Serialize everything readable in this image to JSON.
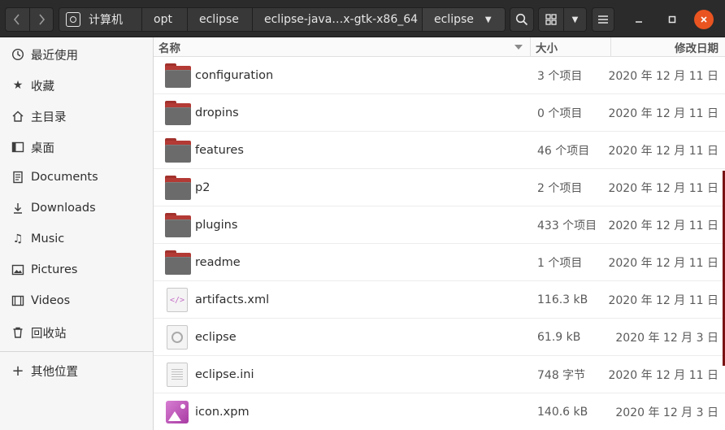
{
  "header": {
    "back_icon": "chevron-left-icon",
    "forward_icon": "chevron-right-icon",
    "breadcrumbs": [
      "计算机",
      "opt",
      "eclipse",
      "eclipse-java…x-gtk-x86_64",
      "eclipse"
    ],
    "search_icon": "search-icon",
    "view_icon": "grid-view-icon",
    "menu_icon": "hamburger-menu-icon",
    "window_controls": [
      "minimize",
      "maximize",
      "close"
    ],
    "close_color": "#e95420"
  },
  "sidebar": {
    "items": [
      {
        "label": "最近使用",
        "icon": "clock-icon"
      },
      {
        "label": "收藏",
        "icon": "star-icon"
      },
      {
        "label": "主目录",
        "icon": "home-icon"
      },
      {
        "label": "桌面",
        "icon": "desktop-icon"
      },
      {
        "label": "Documents",
        "icon": "document-icon"
      },
      {
        "label": "Downloads",
        "icon": "download-icon"
      },
      {
        "label": "Music",
        "icon": "music-icon"
      },
      {
        "label": "Pictures",
        "icon": "image-icon"
      },
      {
        "label": "Videos",
        "icon": "film-icon"
      },
      {
        "label": "回收站",
        "icon": "trash-icon"
      },
      {
        "label": "其他位置",
        "icon": "plus-icon"
      }
    ]
  },
  "columns": {
    "name": "名称",
    "size": "大小",
    "modified": "修改日期"
  },
  "files": [
    {
      "name": "configuration",
      "size": "3 个项目",
      "modified": "2020 年 12 月 11 日",
      "type": "folder"
    },
    {
      "name": "dropins",
      "size": "0 个项目",
      "modified": "2020 年 12 月 11 日",
      "type": "folder"
    },
    {
      "name": "features",
      "size": "46 个项目",
      "modified": "2020 年 12 月 11 日",
      "type": "folder"
    },
    {
      "name": "p2",
      "size": "2 个项目",
      "modified": "2020 年 12 月 11 日",
      "type": "folder"
    },
    {
      "name": "plugins",
      "size": "433 个项目",
      "modified": "2020 年 12 月 11 日",
      "type": "folder"
    },
    {
      "name": "readme",
      "size": "1 个项目",
      "modified": "2020 年 12 月 11 日",
      "type": "folder"
    },
    {
      "name": "artifacts.xml",
      "size": "116.3 kB",
      "modified": "2020 年 12 月 11 日",
      "type": "xml"
    },
    {
      "name": "eclipse",
      "size": "61.9 kB",
      "modified": "2020 年 12 月 3 日",
      "type": "executable"
    },
    {
      "name": "eclipse.ini",
      "size": "748 字节",
      "modified": "2020 年 12 月 11 日",
      "type": "text"
    },
    {
      "name": "icon.xpm",
      "size": "140.6 kB",
      "modified": "2020 年 12 月 3 日",
      "type": "image"
    }
  ]
}
